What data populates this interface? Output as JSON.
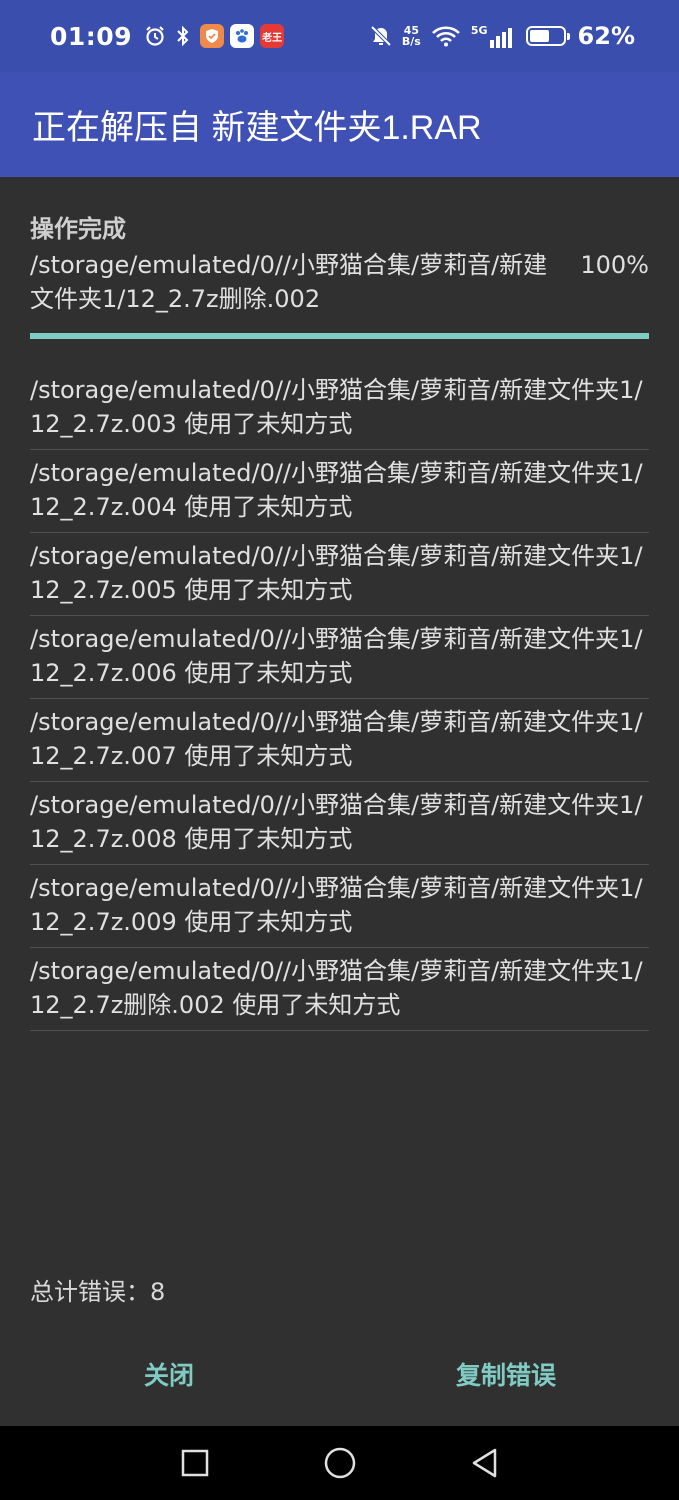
{
  "status_bar": {
    "time": "01:09",
    "net_speed_value": "45",
    "net_speed_unit": "B/s",
    "network": "5G",
    "battery_percent": "62%",
    "battery_level": 0.62,
    "notif_badge_text": "老王",
    "icons": [
      "alarm-icon",
      "bluetooth-icon",
      "shield-app-icon",
      "baidu-app-icon",
      "laowang-app-icon",
      "mute-icon",
      "wifi-icon",
      "signal-icon",
      "battery-icon"
    ]
  },
  "header": {
    "title": "正在解压自 新建文件夹1.RAR"
  },
  "progress": {
    "status": "操作完成",
    "current_path": "/storage/emulated/0//小野猫合集/萝莉音/新建文件夹1/12_2.7z删除.002",
    "percent_label": "100%",
    "value": 1.0
  },
  "errors": [
    "/storage/emulated/0//小野猫合集/萝莉音/新建文件夹1/12_2.7z.003 使用了未知方式",
    "/storage/emulated/0//小野猫合集/萝莉音/新建文件夹1/12_2.7z.004 使用了未知方式",
    "/storage/emulated/0//小野猫合集/萝莉音/新建文件夹1/12_2.7z.005 使用了未知方式",
    "/storage/emulated/0//小野猫合集/萝莉音/新建文件夹1/12_2.7z.006 使用了未知方式",
    "/storage/emulated/0//小野猫合集/萝莉音/新建文件夹1/12_2.7z.007 使用了未知方式",
    "/storage/emulated/0//小野猫合集/萝莉音/新建文件夹1/12_2.7z.008 使用了未知方式",
    "/storage/emulated/0//小野猫合集/萝莉音/新建文件夹1/12_2.7z.009 使用了未知方式",
    "/storage/emulated/0//小野猫合集/萝莉音/新建文件夹1/12_2.7z删除.002 使用了未知方式"
  ],
  "summary": {
    "total_errors": "总计错误：8"
  },
  "actions": {
    "close_label": "关闭",
    "copy_errors_label": "复制错误"
  },
  "colors": {
    "status_bar_bg": "#3a4eae",
    "title_bar_bg": "#3f51b5",
    "background": "#303030",
    "accent": "#80cbc4"
  },
  "nav": {
    "icons": [
      "recents-square-icon",
      "home-circle-icon",
      "back-triangle-icon"
    ]
  }
}
